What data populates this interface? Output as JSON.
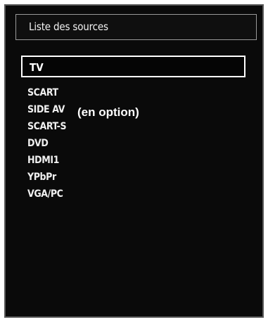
{
  "panel": {
    "title": "Liste des sources",
    "selected": "TV",
    "items": [
      "SCART",
      "SIDE AV",
      "SCART-S",
      "DVD",
      "HDMI1",
      "YPbPr",
      "VGA/PC"
    ],
    "option_note": "(en option)"
  }
}
